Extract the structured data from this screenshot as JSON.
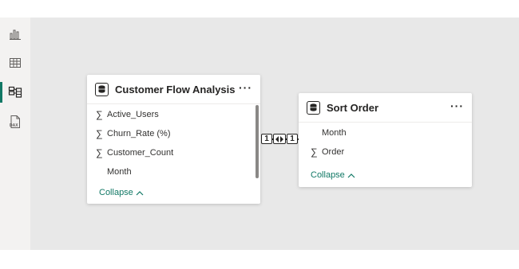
{
  "left_rail": {
    "items": [
      {
        "icon": "report-view-icon"
      },
      {
        "icon": "table-view-icon"
      },
      {
        "icon": "model-view-icon",
        "active": true
      },
      {
        "icon": "dax-query-view-icon"
      }
    ],
    "accent_color": "#117865"
  },
  "tables": [
    {
      "title": "Customer Flow Analysis",
      "more_label": "···",
      "fields": [
        {
          "label": "Active_Users",
          "aggregate": true
        },
        {
          "label": "Churn_Rate (%)",
          "aggregate": true
        },
        {
          "label": "Customer_Count",
          "aggregate": true
        },
        {
          "label": "Month",
          "aggregate": false
        }
      ],
      "collapse_label": "Collapse"
    },
    {
      "title": "Sort Order",
      "more_label": "···",
      "fields": [
        {
          "label": "Month",
          "aggregate": false
        },
        {
          "label": "Order",
          "aggregate": true
        }
      ],
      "collapse_label": "Collapse"
    }
  ],
  "relationship": {
    "from_cardinality": "1",
    "to_cardinality": "1",
    "cross_filter": "both"
  },
  "sigma_symbol": "∑"
}
